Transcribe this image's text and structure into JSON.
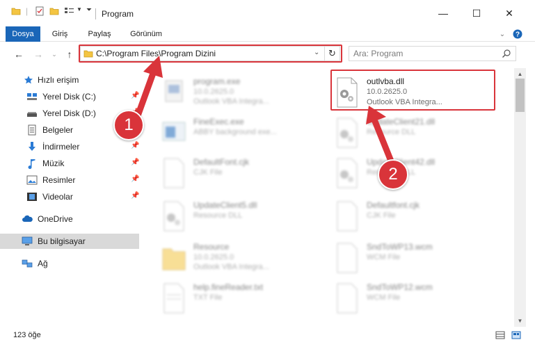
{
  "window": {
    "title": "Program",
    "controls": {
      "minimize": "—",
      "maximize": "☐",
      "close": "✕"
    }
  },
  "ribbon": {
    "tabs": [
      {
        "label": "Dosya",
        "active": true
      },
      {
        "label": "Giriş",
        "active": false
      },
      {
        "label": "Paylaş",
        "active": false
      },
      {
        "label": "Görünüm",
        "active": false
      }
    ]
  },
  "navigation": {
    "address": "C:\\Program Files\\Program Dizini",
    "search_placeholder": "Ara: Program"
  },
  "sidebar": {
    "items": [
      {
        "label": "Hızlı erişim",
        "icon": "star-icon",
        "pinned": false
      },
      {
        "label": "Yerel Disk (C:)",
        "icon": "drive-icon",
        "pinned": true
      },
      {
        "label": "Yerel Disk (D:)",
        "icon": "drive-icon",
        "pinned": true
      },
      {
        "label": "Belgeler",
        "icon": "documents-icon",
        "pinned": true
      },
      {
        "label": "İndirmeler",
        "icon": "download-icon",
        "pinned": true
      },
      {
        "label": "Müzik",
        "icon": "music-icon",
        "pinned": true
      },
      {
        "label": "Resimler",
        "icon": "pictures-icon",
        "pinned": true
      },
      {
        "label": "Videolar",
        "icon": "videos-icon",
        "pinned": true
      },
      {
        "label": "OneDrive",
        "icon": "cloud-icon",
        "pinned": false
      },
      {
        "label": "Bu bilgisayar",
        "icon": "computer-icon",
        "pinned": false,
        "selected": true
      },
      {
        "label": "Ağ",
        "icon": "network-icon",
        "pinned": false
      }
    ]
  },
  "files": [
    {
      "name": "program.exe",
      "line2": "10.0.2625.0",
      "line3": "Outlook VBA Integra...",
      "icon": "exe-icon",
      "blurred": true
    },
    {
      "name": "outlvba.dll",
      "line2": "10.0.2625.0",
      "line3": "Outlook VBA Integra...",
      "icon": "dll-gear-icon",
      "blurred": false,
      "highlighted": true
    },
    {
      "name": "FineExec.exe",
      "line2": "ABBY background exe...",
      "line3": "",
      "icon": "window-exe-icon",
      "blurred": true
    },
    {
      "name": "UpdateClient21.dll",
      "line2": "Resource DLL",
      "line3": "",
      "icon": "dll-gear-icon",
      "blurred": true
    },
    {
      "name": "DefaultFont.cjk",
      "line2": "CJK File",
      "line3": "",
      "icon": "blank-file-icon",
      "blurred": true
    },
    {
      "name": "UpdateClient42.dll",
      "line2": "Resource DLL",
      "line3": "",
      "icon": "dll-gear-icon",
      "blurred": true
    },
    {
      "name": "UpdateClient5.dll",
      "line2": "Resource DLL",
      "line3": "",
      "icon": "dll-gear-icon",
      "blurred": true
    },
    {
      "name": "Defaultfont.cjk",
      "line2": "CJK File",
      "line3": "",
      "icon": "blank-file-icon",
      "blurred": true
    },
    {
      "name": "Resource",
      "line2": "10.0.2625.0",
      "line3": "Outlook VBA Integra...",
      "icon": "folder-icon",
      "blurred": true
    },
    {
      "name": "SndToWP13.wcm",
      "line2": "WCM File",
      "line3": "",
      "icon": "blank-file-icon",
      "blurred": true
    },
    {
      "name": "help.fineReader.txt",
      "line2": "TXT File",
      "line3": "",
      "icon": "text-file-icon",
      "blurred": true
    },
    {
      "name": "SndToWP12.wcm",
      "line2": "WCM File",
      "line3": "",
      "icon": "blank-file-icon",
      "blurred": true
    }
  ],
  "status": {
    "item_count": "123 öğe"
  },
  "annotations": {
    "callout_1": "1",
    "callout_2": "2"
  },
  "colors": {
    "accent": "#1a66b8",
    "highlight": "#d9343a",
    "selected": "#d9d9d9"
  }
}
